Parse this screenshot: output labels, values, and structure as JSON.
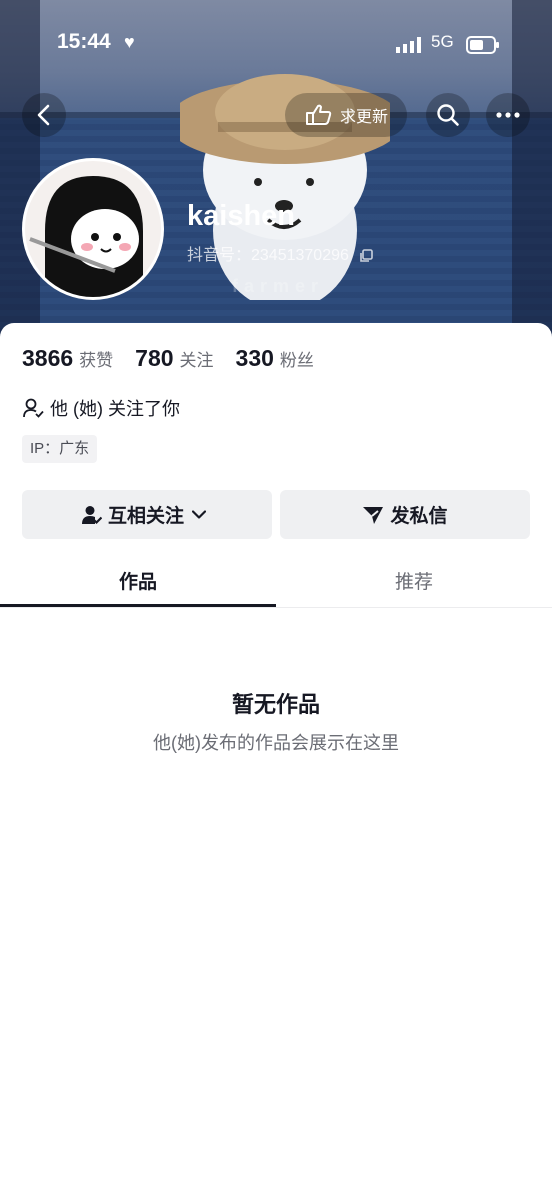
{
  "status_bar": {
    "time": "15:44",
    "network": "5G"
  },
  "nav": {
    "update_label": "求更新"
  },
  "banner": {
    "watermark": "farmer"
  },
  "profile": {
    "username": "kaishen",
    "douyin_id": "抖音号：23451370296"
  },
  "stats": [
    {
      "value": "3866",
      "label": "获赞"
    },
    {
      "value": "780",
      "label": "关注"
    },
    {
      "value": "330",
      "label": "粉丝"
    }
  ],
  "follows_you": "他 (她) 关注了你",
  "ip_location": "IP：广东",
  "actions": {
    "mutual_follow": "互相关注",
    "message": "发私信"
  },
  "tabs": [
    {
      "label": "作品"
    },
    {
      "label": "推荐"
    }
  ],
  "empty_state": {
    "title": "暂无作品",
    "subtitle": "他(她)发布的作品会展示在这里"
  },
  "colors": {
    "banner": "#2d4a78",
    "text": "#161823",
    "muted": "#6b6d75",
    "button_bg": "#eff0f2"
  }
}
